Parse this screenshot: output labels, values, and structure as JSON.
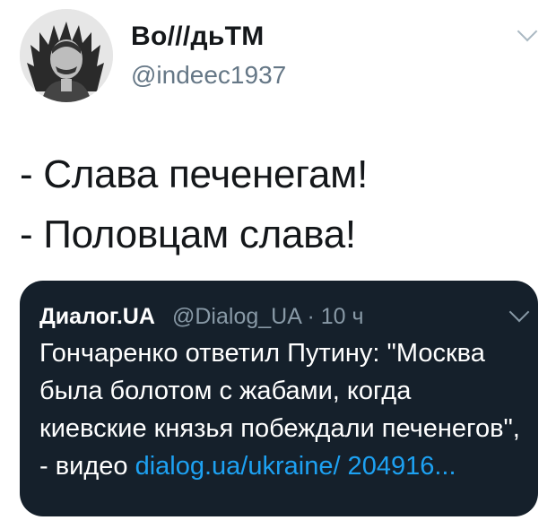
{
  "author": {
    "name": "Во///дьTM",
    "handle": "@indeec1937"
  },
  "tweet": {
    "lines": [
      "- Слава печенегам!",
      "- Половцам слава!"
    ]
  },
  "quoted": {
    "author": "Диалог.UA",
    "meta": "@Dialog_UA · 10 ч",
    "text": "Гончаренко ответил Путину: \"Москва была болотом с жабами, когда киевские князья побеждали печенегов\", - видео",
    "link": "dialog.ua/ukraine/ 204916..."
  },
  "icons": {
    "avatar": "avatar-portrait",
    "menu": "chevron-down-icon"
  }
}
